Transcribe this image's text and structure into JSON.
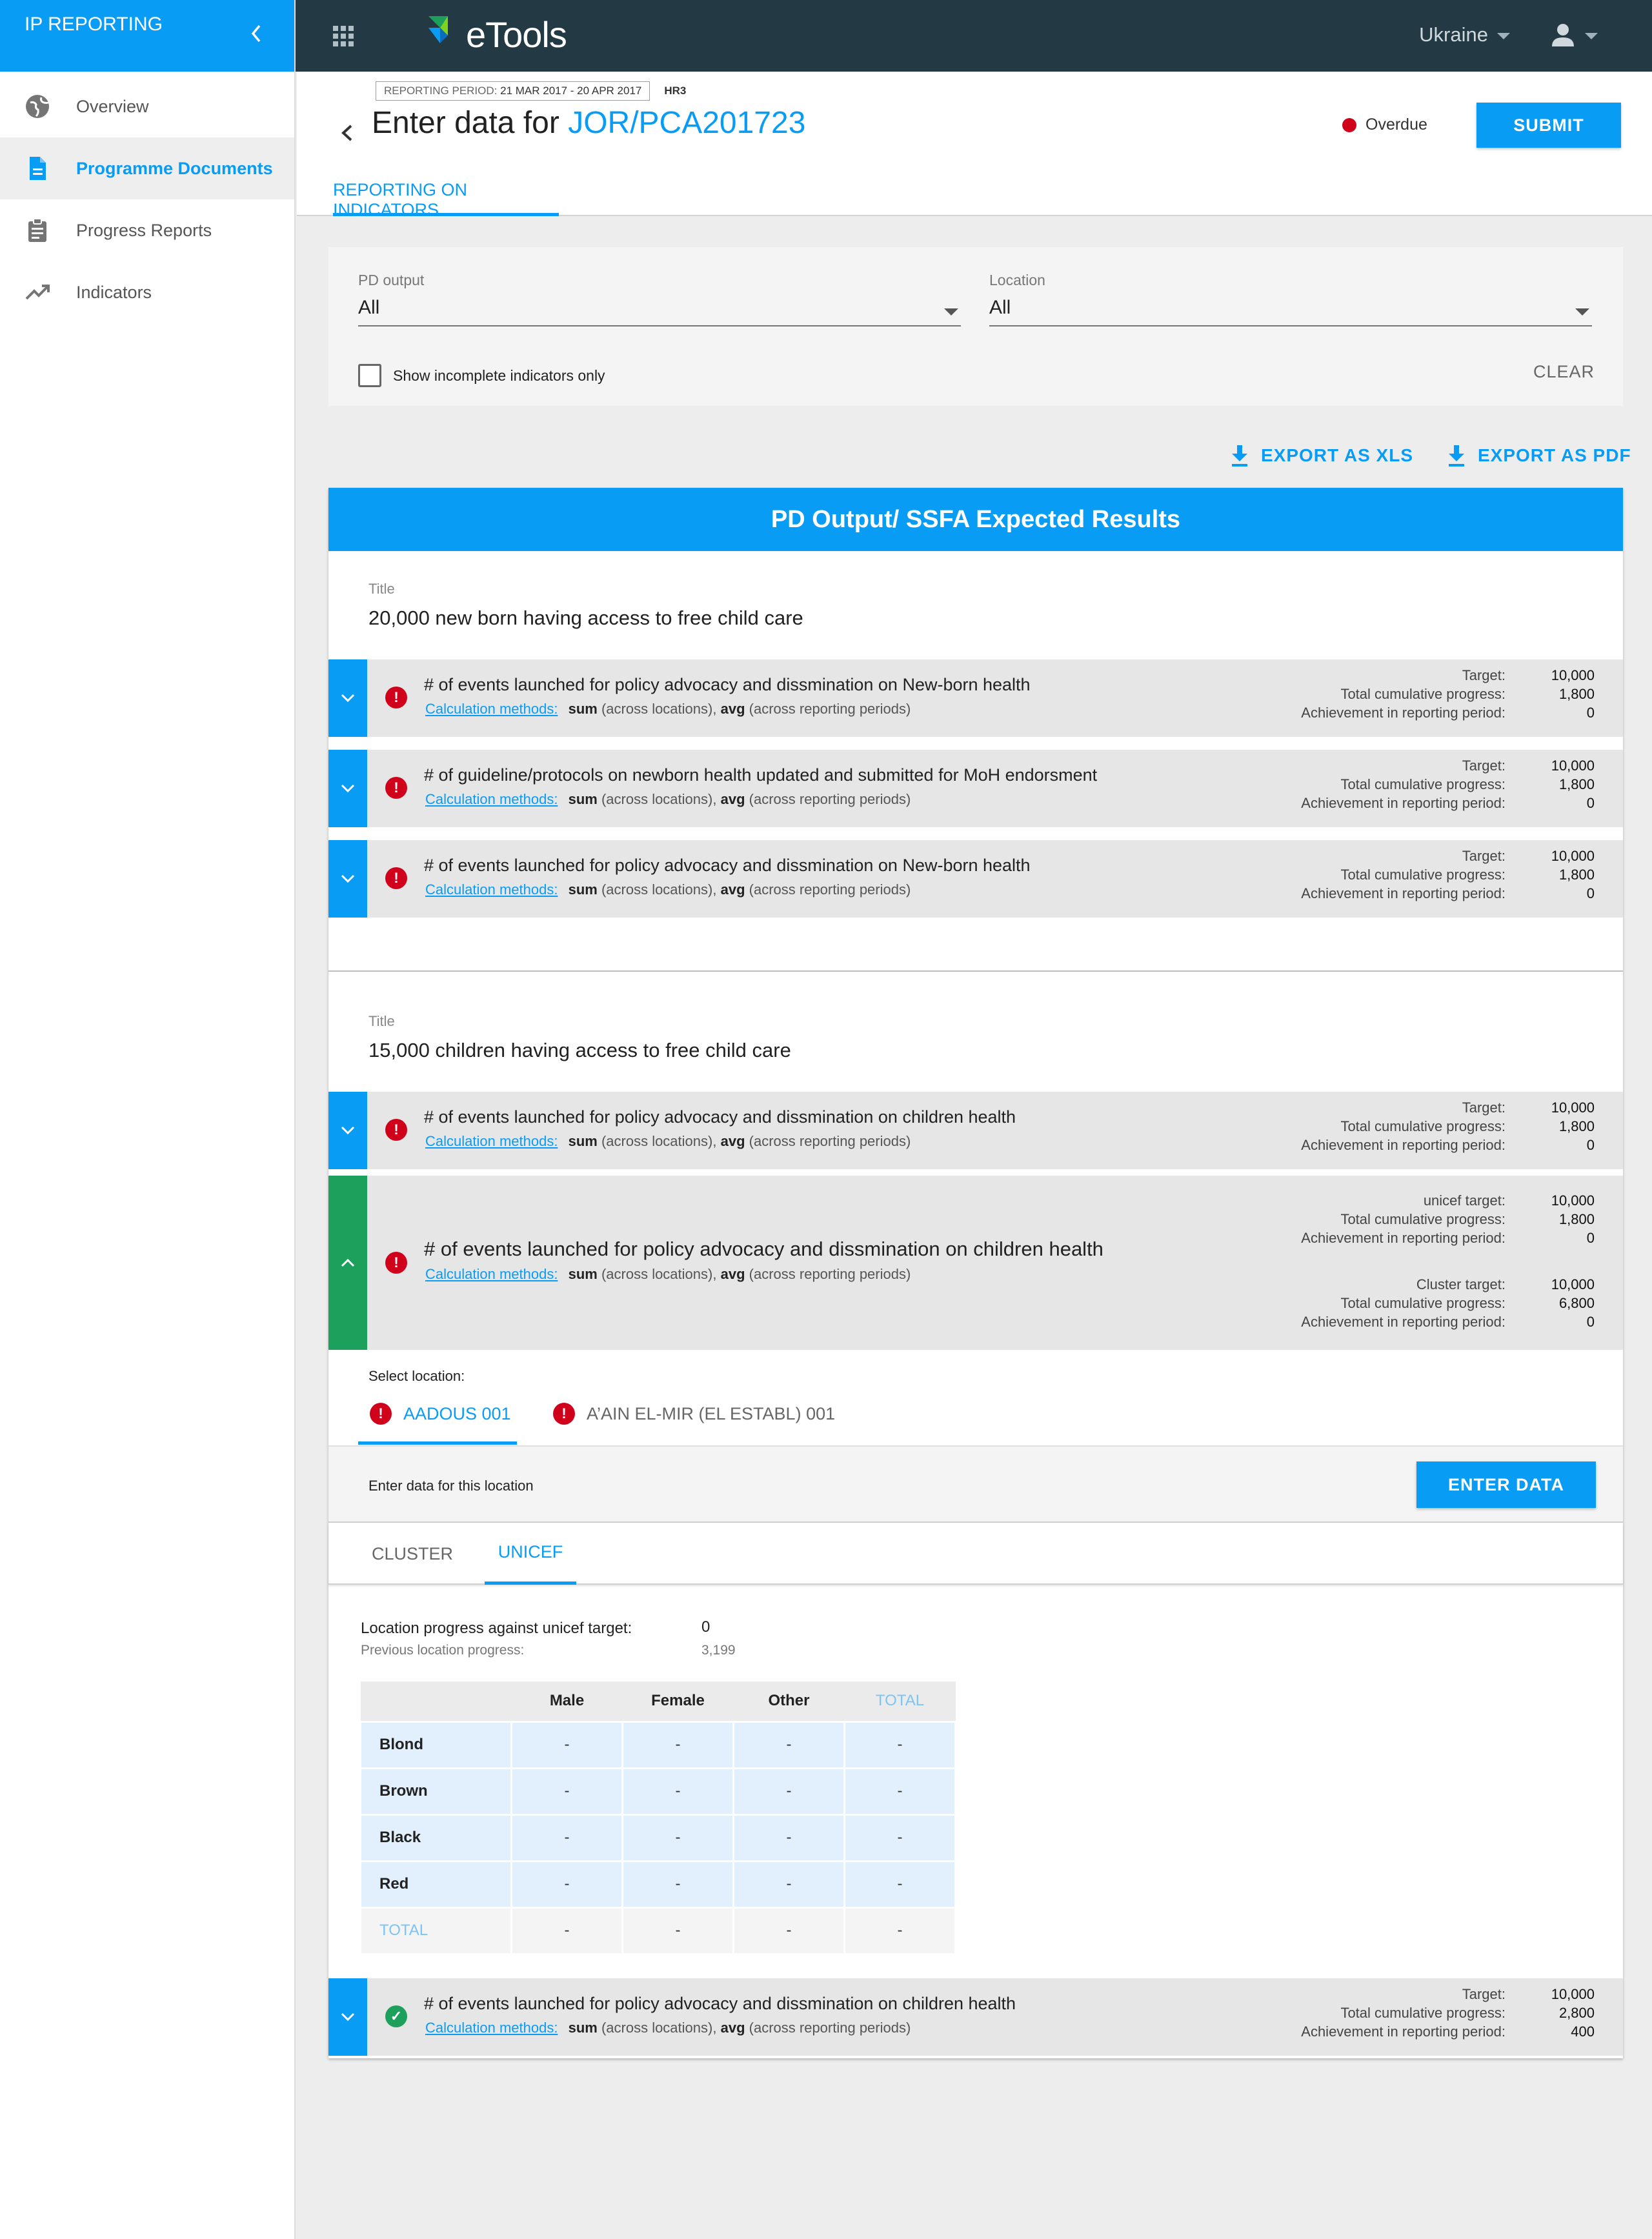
{
  "sidebar": {
    "brand": "IP REPORTING",
    "items": [
      {
        "label": "Overview",
        "icon": "globe-icon"
      },
      {
        "label": "Programme Documents",
        "icon": "document-icon"
      },
      {
        "label": "Progress Reports",
        "icon": "clipboard-icon"
      },
      {
        "label": "Indicators",
        "icon": "trending-up-icon"
      }
    ]
  },
  "topbar": {
    "logo_text": "eTools",
    "country": "Ukraine"
  },
  "header": {
    "period_label": "REPORTING PERIOD:",
    "period_value": "21 MAR 2017 - 20 APR 2017",
    "period_code": "HR3",
    "title_prefix": "Enter data for",
    "title_ref": "JOR/PCA201723",
    "status": "Overdue",
    "submit": "SUBMIT",
    "tab": "REPORTING ON INDICATORS"
  },
  "filters": {
    "pd_output_label": "PD output",
    "pd_output_value": "All",
    "location_label": "Location",
    "location_value": "All",
    "incomplete_label": "Show incomplete indicators only",
    "clear": "CLEAR"
  },
  "export": {
    "xls": "EXPORT AS XLS",
    "pdf": "EXPORT AS PDF"
  },
  "card": {
    "header": "PD Output/ SSFA Expected Results",
    "title_label": "Title",
    "calc_link": "Calculation methods:",
    "calc_sum": "sum",
    "calc_sum_note": "(across locations),",
    "calc_avg": "avg",
    "calc_avg_note": "(across reporting periods)",
    "stat_labels": {
      "target": "Target:",
      "cumulative": "Total cumulative progress:",
      "achievement": "Achievement in reporting period:",
      "unicef_target": "unicef target:",
      "cluster_target": "Cluster target:"
    },
    "sections": [
      {
        "title": "20,000 new born having access to free child care",
        "indicators": [
          {
            "title": "# of events launched for policy advocacy and dissmination on New-born health",
            "target": "10,000",
            "cumulative": "1,800",
            "achievement": "0"
          },
          {
            "title": "# of guideline/protocols on newborn health updated and submitted for MoH endorsment",
            "target": "10,000",
            "cumulative": "1,800",
            "achievement": "0"
          },
          {
            "title": "# of events launched for policy advocacy and dissmination on New-born health",
            "target": "10,000",
            "cumulative": "1,800",
            "achievement": "0"
          }
        ]
      },
      {
        "title": "15,000 children having access to free child care",
        "indicators": [
          {
            "title": "# of events launched for policy advocacy and dissmination on children health",
            "target": "10,000",
            "cumulative": "1,800",
            "achievement": "0"
          },
          {
            "title": "# of events launched for policy advocacy and dissmination on children health",
            "unicef_target": "10,000",
            "unicef_cumulative": "1,800",
            "unicef_achievement": "0",
            "cluster_target": "10,000",
            "cluster_cumulative": "6,800",
            "cluster_achievement": "0"
          },
          {
            "title": "# of events launched for policy advocacy and dissmination on children health",
            "target": "10,000",
            "cumulative": "2,800",
            "achievement": "400"
          }
        ]
      }
    ],
    "location": {
      "select_label": "Select location:",
      "tabs": [
        "AADOUS 001",
        "A’AIN EL-MIR (EL ESTABL) 001"
      ],
      "enter_label": "Enter data for this location",
      "enter_button": "ENTER DATA",
      "sub_tabs": [
        "CLUSTER",
        "UNICEF"
      ],
      "progress_label": "Location progress against unicef target:",
      "progress_value": "0",
      "previous_label": "Previous location progress:",
      "previous_value": "3,199",
      "table": {
        "columns": [
          "Male",
          "Female",
          "Other",
          "TOTAL"
        ],
        "rows": [
          {
            "label": "Blond",
            "cells": [
              "-",
              "-",
              "-",
              "-"
            ]
          },
          {
            "label": "Brown",
            "cells": [
              "-",
              "-",
              "-",
              "-"
            ]
          },
          {
            "label": "Black",
            "cells": [
              "-",
              "-",
              "-",
              "-"
            ]
          },
          {
            "label": "Red",
            "cells": [
              "-",
              "-",
              "-",
              "-"
            ]
          }
        ],
        "total_row": {
          "label": "TOTAL",
          "cells": [
            "-",
            "-",
            "-",
            "-"
          ]
        }
      }
    }
  },
  "colors": {
    "primary": "#099cf5",
    "topbar": "#233944",
    "overdue": "#d0021b",
    "met": "#1ea05d"
  }
}
